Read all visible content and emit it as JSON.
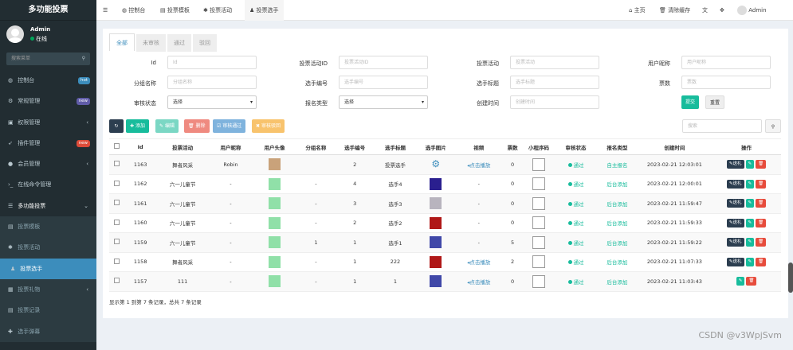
{
  "app": {
    "title": "多功能投票",
    "user": "Admin",
    "status": "在线",
    "search_placeholder": "搜索菜单"
  },
  "menu": [
    {
      "icon": "dashboard-icon",
      "glyph": "◍",
      "label": "控制台",
      "badge": "hot",
      "badge_color": "#3c8dbc"
    },
    {
      "icon": "cogs-icon",
      "glyph": "⚙",
      "label": "常规管理",
      "badge": "new",
      "badge_color": "#605ca8"
    },
    {
      "icon": "lock-icon",
      "glyph": "▣",
      "label": "权限管理",
      "arrow": "‹"
    },
    {
      "icon": "rocket-icon",
      "glyph": "➶",
      "label": "插件管理",
      "badge": "new",
      "badge_color": "#dd4b39"
    },
    {
      "icon": "user-icon",
      "glyph": "●",
      "label": "会员管理",
      "arrow": "‹"
    },
    {
      "icon": "terminal-icon",
      "glyph": "›_",
      "label": "在线命令管理"
    },
    {
      "icon": "list-icon",
      "glyph": "☰",
      "label": "多功能投票",
      "arrow": "⌄",
      "open": true
    },
    {
      "icon": "template-icon",
      "glyph": "▤",
      "label": "投票模板",
      "sub": true
    },
    {
      "icon": "activity-icon",
      "glyph": "✱",
      "label": "投票活动",
      "sub": true
    },
    {
      "icon": "users-icon",
      "glyph": "♟",
      "label": "投票选手",
      "sub": true,
      "active": true
    },
    {
      "icon": "gift-icon",
      "glyph": "▦",
      "label": "投票礼物",
      "sub": true,
      "arrow": "‹"
    },
    {
      "icon": "record-icon",
      "glyph": "▤",
      "label": "投票记录",
      "sub": true
    },
    {
      "icon": "popup-icon",
      "glyph": "✚",
      "label": "选手弹幕",
      "sub": true
    }
  ],
  "topbar": {
    "tabs": [
      {
        "icon": "◍",
        "label": "控制台"
      },
      {
        "icon": "▤",
        "label": "投票模板"
      },
      {
        "icon": "✱",
        "label": "投票活动"
      },
      {
        "icon": "♟",
        "label": "投票选手",
        "active": true
      }
    ],
    "home": "主页",
    "clear_cache": "清除缓存",
    "user": "Admin"
  },
  "status_tabs": [
    "全部",
    "未审核",
    "通过",
    "驳回"
  ],
  "filters": {
    "id": "Id",
    "id_ph": "Id",
    "activity_id": "投票活动ID",
    "activity_id_ph": "投票活动ID",
    "activity": "投票活动",
    "activity_ph": "投票活动",
    "nick": "用户昵称",
    "nick_ph": "用户昵称",
    "group": "分组名称",
    "group_ph": "分组名称",
    "number": "选手编号",
    "number_ph": "选手编号",
    "title": "选手标题",
    "title_ph": "选手标题",
    "votes": "票数",
    "votes_ph": "票数",
    "audit": "审核状态",
    "audit_val": "选择",
    "signup": "报名类型",
    "signup_val": "选择",
    "ctime": "创建时间",
    "ctime_ph": "创建时间",
    "submit": "提交",
    "reset": "重置"
  },
  "toolbar": {
    "add": "添加",
    "edit": "编辑",
    "delete": "删除",
    "approve": "审核通过",
    "reject": "审核驳回",
    "search_ph": "搜索"
  },
  "table": {
    "headers": [
      "Id",
      "投票活动",
      "用户昵称",
      "用户头像",
      "分组名称",
      "选手编号",
      "选手标题",
      "选手图片",
      "视频",
      "票数",
      "小程序码",
      "审核状态",
      "报名类型",
      "创建时间",
      "操作"
    ],
    "rows": [
      {
        "id": "1163",
        "act": "舞者风采",
        "nick": "Robin",
        "avatar": "#c9a27a",
        "group": "",
        "num": "2",
        "title": "投票选手",
        "img": "gear",
        "video": "点击播放",
        "votes": "0",
        "audit": "通过",
        "type": "自主报名",
        "time": "2023-02-21 12:03:01",
        "gift": true
      },
      {
        "id": "1162",
        "act": "六一儿童节",
        "nick": "-",
        "avatar": "#90e0a8",
        "group": "-",
        "num": "4",
        "title": "选手4",
        "img": "#2a1f8f",
        "video": "-",
        "votes": "0",
        "audit": "通过",
        "type": "后台添加",
        "time": "2023-02-21 12:00:01",
        "gift": true
      },
      {
        "id": "1161",
        "act": "六一儿童节",
        "nick": "-",
        "avatar": "#90e0a8",
        "group": "-",
        "num": "3",
        "title": "选手3",
        "img": "#b8b4be",
        "video": "-",
        "votes": "0",
        "audit": "通过",
        "type": "后台添加",
        "time": "2023-02-21 11:59:47",
        "gift": true
      },
      {
        "id": "1160",
        "act": "六一儿童节",
        "nick": "-",
        "avatar": "#90e0a8",
        "group": "-",
        "num": "2",
        "title": "选手2",
        "img": "#b01818",
        "video": "-",
        "votes": "0",
        "audit": "通过",
        "type": "后台添加",
        "time": "2023-02-21 11:59:33",
        "gift": true
      },
      {
        "id": "1159",
        "act": "六一儿童节",
        "nick": "-",
        "avatar": "#90e0a8",
        "group": "1",
        "num": "1",
        "title": "选手1",
        "img": "#4048a8",
        "video": "-",
        "votes": "5",
        "audit": "通过",
        "type": "后台添加",
        "time": "2023-02-21 11:59:22",
        "gift": true
      },
      {
        "id": "1158",
        "act": "舞者风采",
        "nick": "-",
        "avatar": "#90e0a8",
        "group": "-",
        "num": "1",
        "title": "222",
        "img": "#b01818",
        "video": "点击播放",
        "votes": "2",
        "audit": "通过",
        "type": "后台添加",
        "time": "2023-02-21 11:07:33",
        "gift": true
      },
      {
        "id": "1157",
        "act": "111",
        "nick": "-",
        "avatar": "#90e0a8",
        "group": "-",
        "num": "1",
        "title": "1",
        "img": "#4048a8",
        "video": "点击播放",
        "votes": "0",
        "audit": "通过",
        "type": "后台添加",
        "time": "2023-02-21 11:03:43",
        "gift": false
      }
    ],
    "gift_label": "送礼"
  },
  "footer": "显示第 1 到第 7 条记录，总共 7 条记录",
  "watermark": "CSDN @v3WpjSvm"
}
